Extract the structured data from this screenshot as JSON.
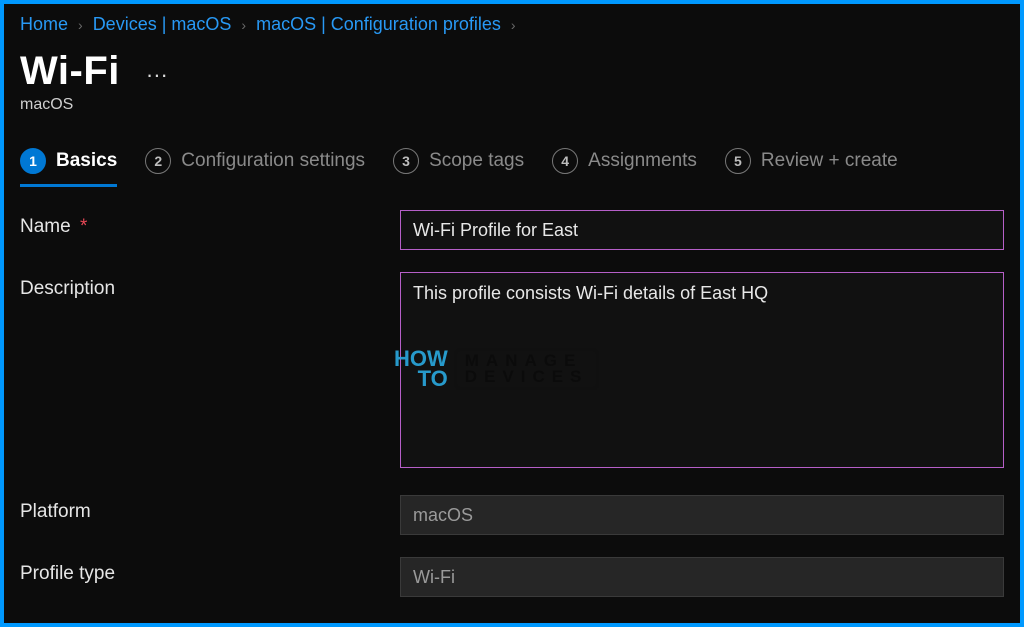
{
  "breadcrumb": {
    "items": [
      {
        "label": "Home"
      },
      {
        "label": "Devices | macOS"
      },
      {
        "label": "macOS | Configuration profiles"
      }
    ]
  },
  "header": {
    "title": "Wi-Fi",
    "subtitle": "macOS",
    "more_label": "···"
  },
  "stepper": {
    "steps": [
      {
        "num": "1",
        "label": "Basics",
        "active": true
      },
      {
        "num": "2",
        "label": "Configuration settings",
        "active": false
      },
      {
        "num": "3",
        "label": "Scope tags",
        "active": false
      },
      {
        "num": "4",
        "label": "Assignments",
        "active": false
      },
      {
        "num": "5",
        "label": "Review + create",
        "active": false
      }
    ]
  },
  "form": {
    "name_label": "Name",
    "name_required": "*",
    "name_value": "Wi-Fi Profile for East",
    "description_label": "Description",
    "description_value": "This profile consists Wi-Fi details of East HQ",
    "platform_label": "Platform",
    "platform_value": "macOS",
    "profile_type_label": "Profile type",
    "profile_type_value": "Wi-Fi"
  },
  "watermark": {
    "how": "HOW",
    "to": "TO",
    "manage": "MANAGE",
    "devices": "DEVICES"
  }
}
